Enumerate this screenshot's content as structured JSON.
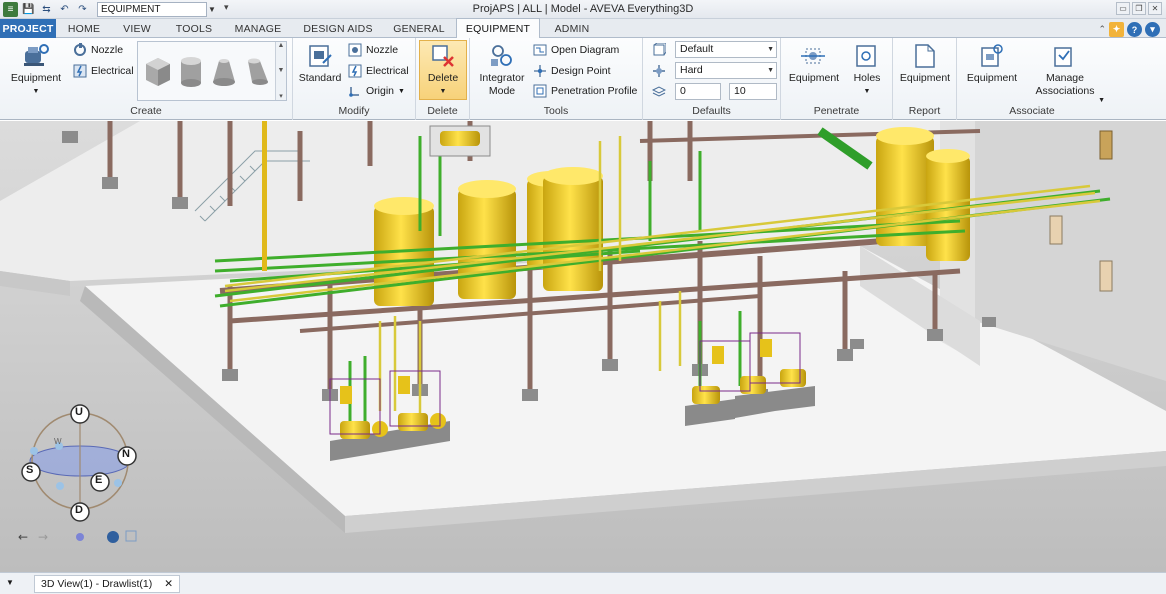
{
  "window": {
    "title": "ProjAPS | ALL | Model - AVEVA Everything3D",
    "module_select": "EQUIPMENT",
    "controls": [
      "▭",
      "❐",
      "✕"
    ]
  },
  "tabs": [
    {
      "label": "PROJECT"
    },
    {
      "label": "HOME"
    },
    {
      "label": "VIEW"
    },
    {
      "label": "TOOLS"
    },
    {
      "label": "MANAGE"
    },
    {
      "label": "DESIGN AIDS"
    },
    {
      "label": "GENERAL"
    },
    {
      "label": "EQUIPMENT"
    },
    {
      "label": "ADMIN"
    }
  ],
  "ribbon": {
    "create": {
      "label": "Create",
      "equipment": "Equipment",
      "nozzle": "Nozzle",
      "electrical": "Electrical"
    },
    "modify": {
      "label": "Modify",
      "standard": "Standard",
      "nozzle": "Nozzle",
      "electrical": "Electrical",
      "origin": "Origin"
    },
    "delete": {
      "label": "Delete",
      "button": "Delete"
    },
    "tools": {
      "label": "Tools",
      "integrator": "Integrator Mode",
      "open_diagram": "Open Diagram",
      "design_point": "Design Point",
      "penetration_profile": "Penetration Profile"
    },
    "defaults": {
      "label": "Defaults",
      "style": "Default",
      "hardness": "Hard",
      "offset": "0",
      "value": "10"
    },
    "penetrate": {
      "label": "Penetrate",
      "equipment": "Equipment",
      "holes": "Holes"
    },
    "report": {
      "label": "Report",
      "equipment": "Equipment"
    },
    "associate": {
      "label": "Associate",
      "equipment": "Equipment",
      "manage": "Manage Associations"
    }
  },
  "compass": {
    "up": "U",
    "down": "D",
    "north": "N",
    "south": "S",
    "east": "E",
    "west": "W"
  },
  "bottom": {
    "doc_tab": "3D View(1) - Drawlist(1)",
    "close": "✕"
  },
  "colors": {
    "accent": "#2f6fb6",
    "steel": "#8a6a60",
    "vessel": "#e6c21a",
    "pipe_green": "#3fae2c",
    "pipe_yellow": "#d8c93a",
    "floor": "#f2f2f2"
  }
}
